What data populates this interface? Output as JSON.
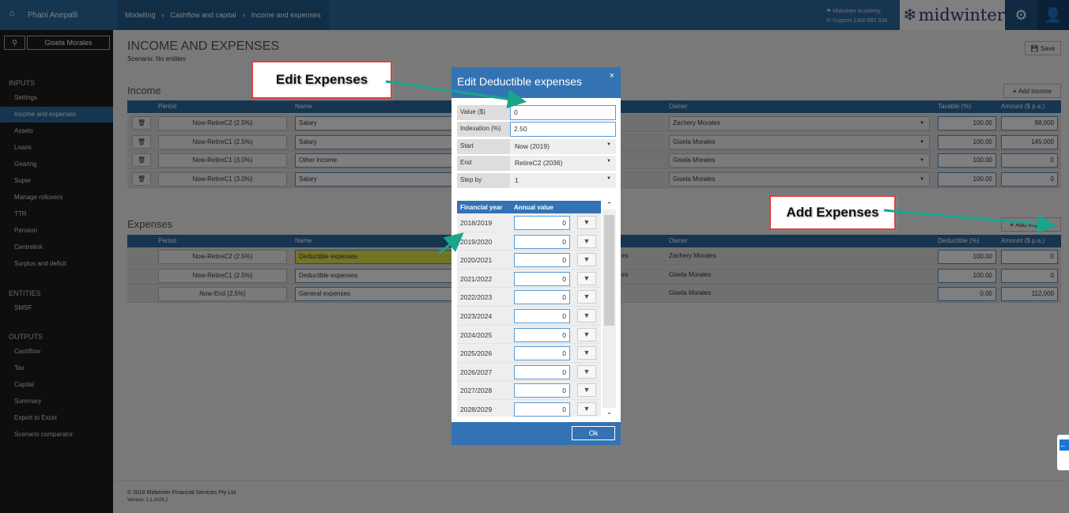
{
  "topbar": {
    "user": "Phani Anepalli",
    "breadcrumbs": [
      "Modelling",
      "Cashflow and capital",
      "Income and expenses"
    ],
    "academy": "Midwinter Academy",
    "support": "Support 1300 882 938",
    "logo": "midwinter",
    "icons": [
      "home-icon",
      "gear-icon",
      "user-icon"
    ]
  },
  "sidebar": {
    "client": "Gisela Morales",
    "inputs_title": "INPUTS",
    "inputs": [
      "Settings",
      "Income and expenses",
      "Assets",
      "Loans",
      "Gearing",
      "Super",
      "Manage rollovers",
      "TTR",
      "Pension",
      "Centrelink",
      "Surplus and deficit"
    ],
    "active": "Income and expenses",
    "entities_title": "ENTITIES",
    "entities": [
      "SMSF"
    ],
    "outputs_title": "OUTPUTS",
    "outputs": [
      "Cashflow",
      "Tax",
      "Capital",
      "Summary",
      "Export to Excel",
      "Scenario comparator"
    ]
  },
  "page": {
    "title": "INCOME AND EXPENSES",
    "scenario": "Scenario: No entities",
    "save": "Save"
  },
  "income": {
    "title": "Income",
    "add": "Add income",
    "headers": {
      "period": "Period",
      "name": "Name",
      "owner": "Owner",
      "taxable": "Taxable (%)",
      "amount": "Amount ($ p.a.)"
    },
    "rows": [
      {
        "period": "Now-RetireC2 (2.5%)",
        "name": "Salary",
        "owner": "Zachery Morales",
        "taxable": "100.00",
        "amount": "98,000"
      },
      {
        "period": "Now-RetireC1 (2.5%)",
        "name": "Salary",
        "owner": "Gisela Morales",
        "taxable": "100.00",
        "amount": "145,000"
      },
      {
        "period": "Now-RetireC1 (3.0%)",
        "name": "Other income",
        "owner": "Gisela Morales",
        "taxable": "100.00",
        "amount": "0"
      },
      {
        "period": "Now-RetireC1 (3.0%)",
        "name": "Salary",
        "owner": "Gisela Morales",
        "taxable": "100.00",
        "amount": "0"
      }
    ]
  },
  "expenses": {
    "title": "Expenses",
    "add": "Add expense",
    "headers": {
      "period": "Period",
      "name": "Name",
      "owner": "Owner",
      "deductible": "Deductible (%)",
      "amount": "Amount ($ p.a.)"
    },
    "rows": [
      {
        "period": "Now-RetireC2 (2.5%)",
        "name": "Deductible expenses",
        "type_tail": "es",
        "owner": "Zachery Morales",
        "deductible": "100.00",
        "amount": "0"
      },
      {
        "period": "Now-RetireC1 (2.5%)",
        "name": "Deductible expenses",
        "type_tail": "es",
        "owner": "Gisela Morales",
        "deductible": "100.00",
        "amount": "0"
      },
      {
        "period": "Now-End (2.5%)",
        "name": "General expenses",
        "type_tail": "",
        "owner": "Gisela Morales",
        "deductible": "0.00",
        "amount": "112,000"
      }
    ]
  },
  "footer": {
    "copyright": "© 2018 Midwinter Financial Services Pty Ltd",
    "version": "Version: 1.1.1029.2"
  },
  "modal": {
    "title": "Edit Deductible expenses",
    "close": "×",
    "fields": {
      "value_label": "Value ($)",
      "value": "0",
      "indexation_label": "Indexation (%)",
      "indexation": "2.50",
      "start_label": "Start",
      "start": "Now (2019)",
      "end_label": "End",
      "end": "RetireC2 (2036)",
      "step_label": "Step by",
      "step": "1"
    },
    "table_headers": {
      "year": "Financial year",
      "value": "Annual value"
    },
    "years": [
      {
        "year": "2018/2019",
        "value": "0"
      },
      {
        "year": "2019/2020",
        "value": "0"
      },
      {
        "year": "2020/2021",
        "value": "0"
      },
      {
        "year": "2021/2022",
        "value": "0"
      },
      {
        "year": "2022/2023",
        "value": "0"
      },
      {
        "year": "2023/2024",
        "value": "0"
      },
      {
        "year": "2024/2025",
        "value": "0"
      },
      {
        "year": "2025/2026",
        "value": "0"
      },
      {
        "year": "2026/2027",
        "value": "0"
      },
      {
        "year": "2027/2028",
        "value": "0"
      },
      {
        "year": "2028/2029",
        "value": "0"
      }
    ],
    "ok": "Ok"
  },
  "annotations": {
    "edit": "Edit Expenses",
    "add": "Add Expenses",
    "arrow_color": "#1aa58a",
    "border_color": "#e0403f"
  }
}
